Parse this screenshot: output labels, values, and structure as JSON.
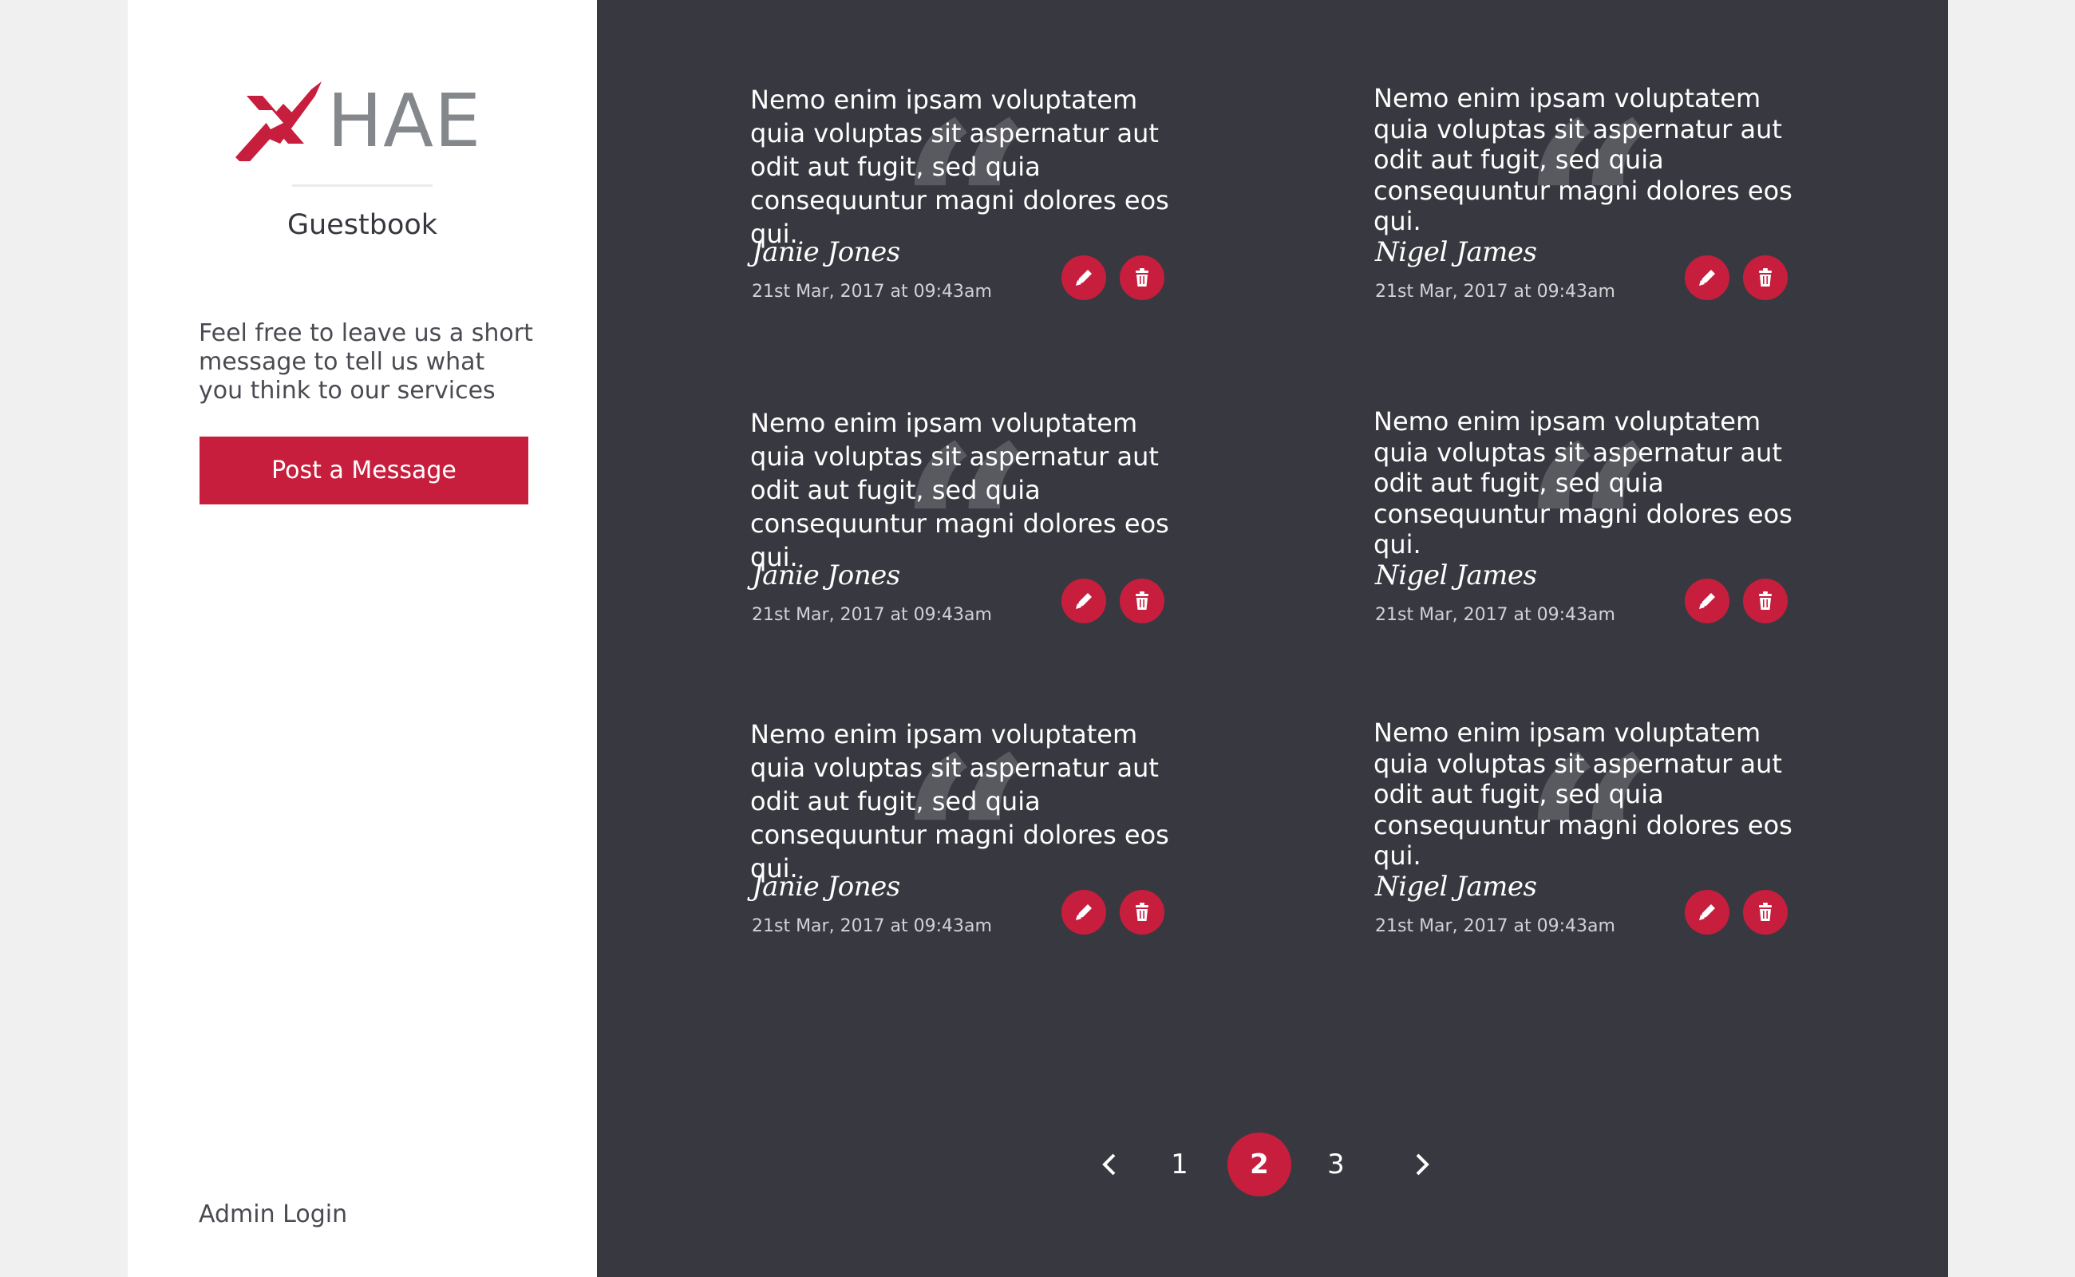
{
  "brand": {
    "logo_text": "HAE",
    "primary_color": "#c81e3d",
    "logo_gray": "#84888c"
  },
  "sidebar": {
    "title": "Guestbook",
    "intro": "Feel free to leave us a short message to tell us what you think to our services",
    "post_button": "Post a Message",
    "admin_link": "Admin Login"
  },
  "entries": [
    {
      "text": "Nemo enim ipsam voluptatem quia voluptas sit aspernatur aut odit aut fugit, sed quia consequuntur magni dolores eos qui.",
      "author": "Janie Jones",
      "date": "21st Mar, 2017 at 09:43am"
    },
    {
      "text": "Nemo enim ipsam voluptatem quia voluptas sit aspernatur aut odit aut fugit, sed quia consequuntur magni dolores eos qui.",
      "author": "Nigel James",
      "date": "21st Mar, 2017 at 09:43am"
    },
    {
      "text": "Nemo enim ipsam voluptatem quia voluptas sit aspernatur aut odit aut fugit, sed quia consequuntur magni dolores eos qui.",
      "author": "Janie Jones",
      "date": "21st Mar, 2017 at 09:43am"
    },
    {
      "text": "Nemo enim ipsam voluptatem quia voluptas sit aspernatur aut odit aut fugit, sed quia consequuntur magni dolores eos qui.",
      "author": "Nigel James",
      "date": "21st Mar, 2017 at 09:43am"
    },
    {
      "text": "Nemo enim ipsam voluptatem quia voluptas sit aspernatur aut odit aut fugit, sed quia consequuntur magni dolores eos qui.",
      "author": "Janie Jones",
      "date": "21st Mar, 2017 at 09:43am"
    },
    {
      "text": "Nemo enim ipsam voluptatem quia voluptas sit aspernatur aut odit aut fugit, sed quia consequuntur magni dolores eos qui.",
      "author": "Nigel James",
      "date": "21st Mar, 2017 at 09:43am"
    }
  ],
  "icons": {
    "edit": "pencil-icon",
    "delete": "trash-icon",
    "prev": "chevron-left-icon",
    "next": "chevron-right-icon"
  },
  "pagination": {
    "pages": [
      "1",
      "2",
      "3"
    ],
    "current": "2"
  }
}
